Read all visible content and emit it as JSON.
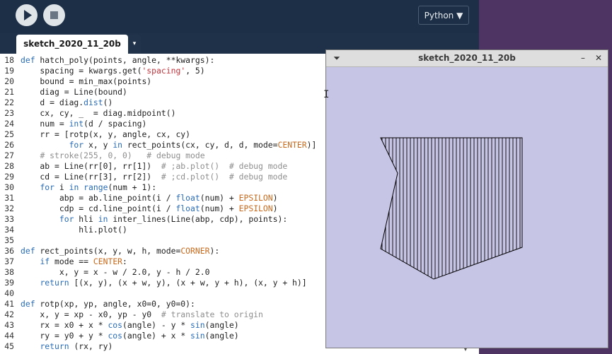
{
  "toolbar": {
    "run_icon": "play-icon",
    "stop_icon": "stop-icon",
    "mode_label": "Python ▼"
  },
  "tab": {
    "label": "sketch_2020_11_20b",
    "menu_icon": "▾"
  },
  "sketch_window": {
    "title": "sketch_2020_11_20b",
    "menu_icon": "⏷",
    "minimize": "–",
    "close": "✕",
    "background": "#c7c5e6"
  },
  "editor": {
    "lines": [
      {
        "n": "18",
        "t": "def hatch_poly(points, angle, **kwargs):"
      },
      {
        "n": "19",
        "t": "    spacing = kwargs.get('spacing', 5)"
      },
      {
        "n": "20",
        "t": "    bound = min_max(points)"
      },
      {
        "n": "21",
        "t": "    diag = Line(bound)"
      },
      {
        "n": "22",
        "t": "    d = diag.dist()"
      },
      {
        "n": "23",
        "t": "    cx, cy, _  = diag.midpoint()"
      },
      {
        "n": "24",
        "t": "    num = int(d / spacing)"
      },
      {
        "n": "25",
        "t": "    rr = [rotp(x, y, angle, cx, cy)"
      },
      {
        "n": "26",
        "t": "          for x, y in rect_points(cx, cy, d, d, mode=CENTER)]"
      },
      {
        "n": "27",
        "t": "    # stroke(255, 0, 0)   # debug mode"
      },
      {
        "n": "28",
        "t": "    ab = Line(rr[0], rr[1])  # ;ab.plot()  # debug mode"
      },
      {
        "n": "29",
        "t": "    cd = Line(rr[3], rr[2])  # ;cd.plot()  # debug mode"
      },
      {
        "n": "30",
        "t": "    for i in range(num + 1):"
      },
      {
        "n": "31",
        "t": "        abp = ab.line_point(i / float(num) + EPSILON)"
      },
      {
        "n": "32",
        "t": "        cdp = cd.line_point(i / float(num) + EPSILON)"
      },
      {
        "n": "33",
        "t": "        for hli in inter_lines(Line(abp, cdp), points):"
      },
      {
        "n": "34",
        "t": "            hli.plot()"
      },
      {
        "n": "35",
        "t": ""
      },
      {
        "n": "36",
        "t": "def rect_points(x, y, w, h, mode=CORNER):"
      },
      {
        "n": "37",
        "t": "    if mode == CENTER:"
      },
      {
        "n": "38",
        "t": "        x, y = x - w / 2.0, y - h / 2.0"
      },
      {
        "n": "39",
        "t": "    return [(x, y), (x + w, y), (x + w, y + h), (x, y + h)]"
      },
      {
        "n": "40",
        "t": ""
      },
      {
        "n": "41",
        "t": "def rotp(xp, yp, angle, x0=0, y0=0):"
      },
      {
        "n": "42",
        "t": "    x, y = xp - x0, yp - y0  # translate to origin"
      },
      {
        "n": "43",
        "t": "    rx = x0 + x * cos(angle) - y * sin(angle)"
      },
      {
        "n": "44",
        "t": "    ry = y0 + y * cos(angle) + x * sin(angle)"
      },
      {
        "n": "45",
        "t": "    return (rx, ry)"
      }
    ]
  },
  "colors": {
    "keyword": "#2a6cb6",
    "string": "#c2343b",
    "constant": "#c86a1e",
    "comment": "#8e8e8e",
    "builtin": "#2a6cb6"
  }
}
